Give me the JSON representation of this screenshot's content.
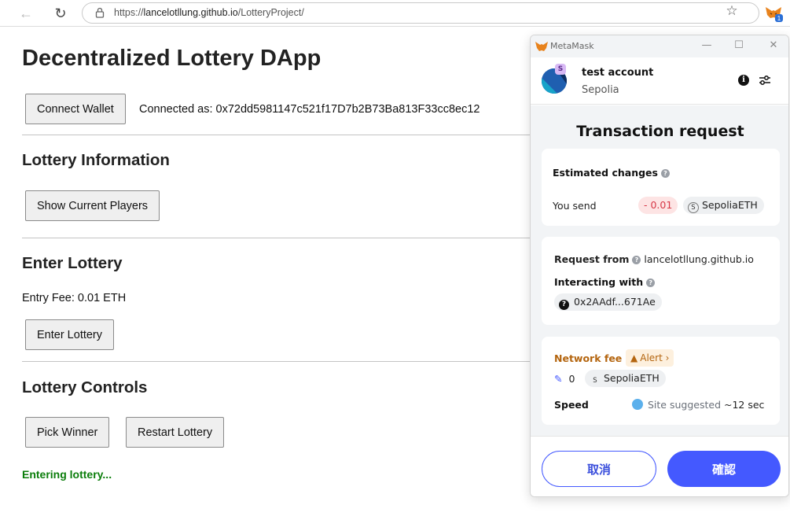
{
  "browser": {
    "url_prefix": "https://",
    "url_host": "lancelotllung.github.io",
    "url_path": "/LotteryProject/",
    "extension_badge": "1"
  },
  "page": {
    "title": "Decentralized Lottery DApp",
    "connect_button": "Connect Wallet",
    "connected_text": "Connected as: 0x72dd5981147c521f17D7b2B73Ba813F33cc8ec12",
    "section_info": "Lottery Information",
    "show_players_button": "Show Current Players",
    "section_enter": "Enter Lottery",
    "entry_fee": "Entry Fee: 0.01 ETH",
    "enter_button": "Enter Lottery",
    "section_controls": "Lottery Controls",
    "pick_winner_button": "Pick Winner",
    "restart_button": "Restart Lottery",
    "status": "Entering lottery..."
  },
  "metamask": {
    "window_title": "MetaMask",
    "account_badge": "S",
    "account_name": "test account",
    "network": "Sepolia",
    "heading": "Transaction request",
    "estimated_changes_label": "Estimated changes",
    "you_send_label": "You send",
    "send_amount": "- 0.01",
    "token_badge": "S",
    "token_name": "SepoliaETH",
    "request_from_label": "Request from",
    "request_from_value": "lancelotllung.github.io",
    "interacting_with_label": "Interacting with",
    "contract_address": "0x2AAdf...671Ae",
    "network_fee_label": "Network fee",
    "alert_label": "Alert",
    "fee_amount": "0",
    "fee_token": "SepoliaETH",
    "speed_label": "Speed",
    "speed_value": "Site suggested",
    "speed_time": "~12 sec",
    "cancel_button": "取消",
    "confirm_button": "確認"
  },
  "colors": {
    "status_green": "#0a7d0a",
    "metamask_blue": "#4459ff",
    "alert_orange": "#b4650f",
    "negative_red": "#d73847"
  }
}
